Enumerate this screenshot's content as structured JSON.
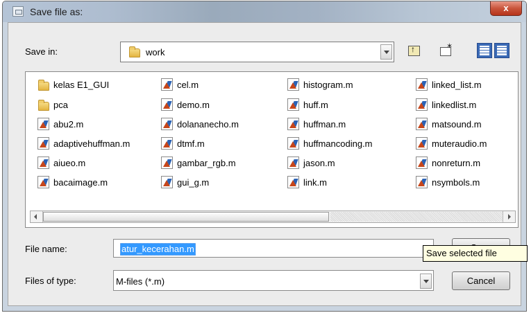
{
  "window": {
    "title": "Save file as:",
    "close_label": "x"
  },
  "save_in": {
    "label": "Save in:",
    "value": "work"
  },
  "toolbar": {
    "up_icon": "up-one-level-icon",
    "new_folder_icon": "new-folder-icon",
    "list_view_icon": "list-view-icon",
    "details_view_icon": "details-view-icon"
  },
  "files": {
    "col1": [
      {
        "name": "kelas E1_GUI",
        "type": "folder"
      },
      {
        "name": "pca",
        "type": "folder"
      },
      {
        "name": "abu2.m",
        "type": "m-file"
      },
      {
        "name": "adaptivehuffman.m",
        "type": "m-file"
      },
      {
        "name": "aiueo.m",
        "type": "m-file"
      },
      {
        "name": "bacaimage.m",
        "type": "m-file"
      }
    ],
    "col2": [
      {
        "name": "cel.m",
        "type": "m-file"
      },
      {
        "name": "demo.m",
        "type": "m-file"
      },
      {
        "name": "dolananecho.m",
        "type": "m-file"
      },
      {
        "name": "dtmf.m",
        "type": "m-file"
      },
      {
        "name": "gambar_rgb.m",
        "type": "m-file"
      },
      {
        "name": "gui_g.m",
        "type": "m-file"
      }
    ],
    "col3": [
      {
        "name": "histogram.m",
        "type": "m-file"
      },
      {
        "name": "huff.m",
        "type": "m-file"
      },
      {
        "name": "huffman.m",
        "type": "m-file"
      },
      {
        "name": "huffmancoding.m",
        "type": "m-file"
      },
      {
        "name": "jason.m",
        "type": "m-file"
      },
      {
        "name": "link.m",
        "type": "m-file"
      }
    ],
    "col4": [
      {
        "name": "linked_list.m",
        "type": "m-file"
      },
      {
        "name": "linkedlist.m",
        "type": "m-file"
      },
      {
        "name": "matsound.m",
        "type": "m-file"
      },
      {
        "name": "muteraudio.m",
        "type": "m-file"
      },
      {
        "name": "nonreturn.m",
        "type": "m-file"
      },
      {
        "name": "nsymbols.m",
        "type": "m-file"
      }
    ]
  },
  "file_name": {
    "label": "File name:",
    "value": "atur_kecerahan.m"
  },
  "file_type": {
    "label": "Files of type:",
    "value": "M-files (*.m)"
  },
  "buttons": {
    "save": "Save",
    "cancel": "Cancel"
  },
  "tooltip": "Save selected file",
  "colors": {
    "selection": "#3399ff",
    "close_button": "#c9553c",
    "view_button": "#3a6ab6",
    "tooltip_bg": "#fffee1"
  }
}
